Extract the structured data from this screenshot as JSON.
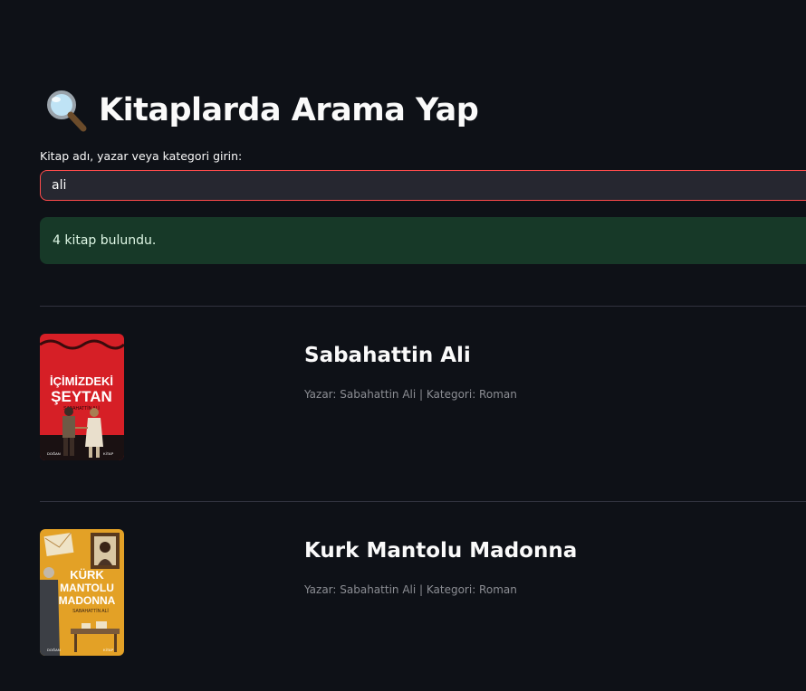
{
  "header": {
    "icon": "magnifying-glass-emoji",
    "title": "Kitaplarda Arama Yap"
  },
  "search": {
    "label": "Kitap adı, yazar veya kategori girin:",
    "value": "ali"
  },
  "result": {
    "message": "4 kitap bulundu."
  },
  "books": [
    {
      "title": "Sabahattin Ali",
      "meta": "Yazar: Sabahattin Ali | Kategori: Roman",
      "cover": {
        "title_line1": "İÇİMİZDEKİ",
        "title_line2": "ŞEYTAN",
        "author": "SABAHATTİN ALİ",
        "color": "#d61f26"
      }
    },
    {
      "title": "Kurk Mantolu Madonna",
      "meta": "Yazar: Sabahattin Ali | Kategori: Roman",
      "cover": {
        "title_line1": "KÜRK",
        "title_line2": "MANTOLU",
        "title_line3": "MADONNA",
        "author": "SABAHATTİN ALİ",
        "color": "#e3a126"
      }
    }
  ],
  "colors": {
    "background": "#0e1117",
    "input_border_focus": "#ff4b4b",
    "success_bg": "#173928"
  }
}
